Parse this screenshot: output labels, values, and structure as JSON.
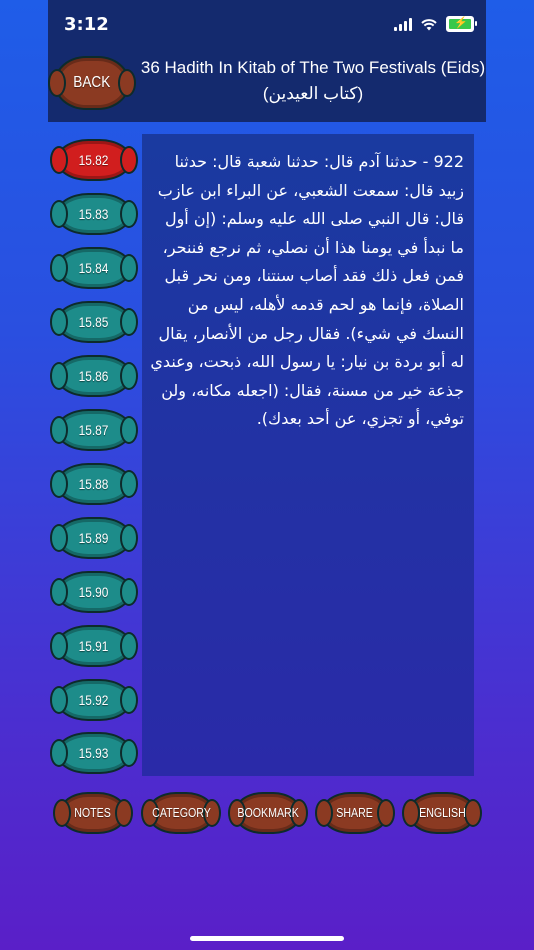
{
  "status": {
    "time": "3:12"
  },
  "header": {
    "back_label": "BACK",
    "title_line1": "36 Hadith In Kitab of The Two Festivals (Eids)",
    "title_line2": "(كتاب العيدين)"
  },
  "hadith_list": {
    "items": [
      {
        "label": "15.82",
        "selected": true
      },
      {
        "label": "15.83"
      },
      {
        "label": "15.84"
      },
      {
        "label": "15.85"
      },
      {
        "label": "15.86"
      },
      {
        "label": "15.87"
      },
      {
        "label": "15.88"
      },
      {
        "label": "15.89"
      },
      {
        "label": "15.90"
      },
      {
        "label": "15.91"
      },
      {
        "label": "15.92"
      },
      {
        "label": "15.93"
      }
    ]
  },
  "hadith_text": "922 - حدثنا آدم قال: حدثنا شعبة قال: حدثنا زبيد قال: سمعت الشعبي، عن البراء ابن عازب قال: قال النبي صلى الله عليه وسلم: (إن أول ما نبدأ في يومنا هذا أن نصلي، ثم نرجع فننحر، فمن فعل ذلك فقد أصاب سنتنا، ومن نحر قبل الصلاة، فإنما هو لحم قدمه لأهله، ليس من النسك في شيء). فقال رجل من الأنصار، يقال له أبو بردة بن نيار: يا رسول الله، ذبحت، وعندي جذعة خير من مسنة، فقال: (اجعله مكانه، ولن توفي، أو تجزي، عن أحد بعدك).",
  "toolbar": {
    "notes": "NOTES",
    "category": "CATEGORY",
    "bookmark": "BOOKMARK",
    "share": "SHARE",
    "english": "ENGLISH"
  },
  "colors": {
    "header_bg": "#142a6e",
    "button_teal": "#1d8c8a",
    "button_selected": "#d11e1e",
    "button_brown": "#8b3a22"
  }
}
